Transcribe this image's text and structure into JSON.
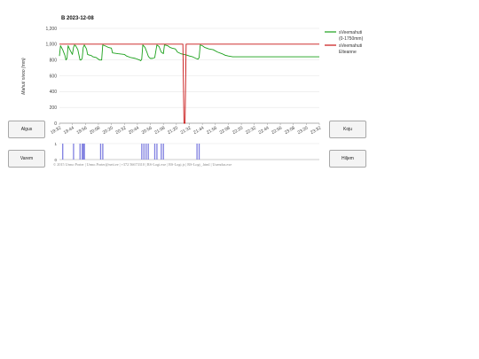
{
  "buttons": {
    "first": "Algus",
    "home": "Koju",
    "earlier": "Varem",
    "later": "Hiljem"
  },
  "footer": "© 2015 Urmo Porter | Urmo.Porter@neti.ee | +372 56673310 | RS-Logi.exe | RS-Logi.js | RS-Logi_.html | Uuendus.exe",
  "chart_data": [
    {
      "type": "line",
      "title": "B 2023-12-08",
      "ylabel": "Mahuti nivoo (mm)",
      "xlabel": "",
      "ylim": [
        0,
        1200
      ],
      "yticks": [
        0,
        200,
        400,
        600,
        800,
        "1,000",
        "1,200"
      ],
      "yticks_values": [
        0,
        200,
        400,
        600,
        800,
        1000,
        1200
      ],
      "xticks": [
        "19:32",
        "19:44",
        "19:56",
        "20:08",
        "20:20",
        "20:32",
        "20:44",
        "20:56",
        "21:08",
        "21:20",
        "21:32",
        "21:44",
        "21:56",
        "22:08",
        "22:20",
        "22:32",
        "22:44",
        "22:56",
        "23:08",
        "23:20",
        "23:32"
      ],
      "x_range": [
        "19:32",
        "23:32"
      ],
      "grid": true,
      "legend_position": "right",
      "colors": {
        "series1": "#1aa01a",
        "series2": "#c81414",
        "axis": "#999999",
        "grid": "#e6e6e6"
      },
      "series": [
        {
          "name": "sVeemahuti (0-1750mm)",
          "points": [
            [
              "19:32",
              850
            ],
            [
              "19:33",
              980
            ],
            [
              "19:35",
              930
            ],
            [
              "19:37",
              860
            ],
            [
              "19:38",
              800
            ],
            [
              "19:39",
              820
            ],
            [
              "19:40",
              980
            ],
            [
              "19:42",
              920
            ],
            [
              "19:44",
              870
            ],
            [
              "19:45",
              960
            ],
            [
              "19:46",
              990
            ],
            [
              "19:47",
              980
            ],
            [
              "19:49",
              930
            ],
            [
              "19:51",
              800
            ],
            [
              "19:52",
              800
            ],
            [
              "19:53",
              820
            ],
            [
              "19:54",
              960
            ],
            [
              "19:55",
              990
            ],
            [
              "19:57",
              940
            ],
            [
              "19:58",
              870
            ],
            [
              "20:00",
              860
            ],
            [
              "20:01",
              860
            ],
            [
              "20:03",
              840
            ],
            [
              "20:06",
              830
            ],
            [
              "20:09",
              800
            ],
            [
              "20:11",
              800
            ],
            [
              "20:12",
              990
            ],
            [
              "20:14",
              980
            ],
            [
              "20:17",
              960
            ],
            [
              "20:20",
              950
            ],
            [
              "20:21",
              890
            ],
            [
              "20:26",
              880
            ],
            [
              "20:32",
              870
            ],
            [
              "20:34",
              850
            ],
            [
              "20:38",
              830
            ],
            [
              "20:42",
              820
            ],
            [
              "20:46",
              800
            ],
            [
              "20:47",
              790
            ],
            [
              "20:48",
              810
            ],
            [
              "20:49",
              990
            ],
            [
              "20:51",
              960
            ],
            [
              "20:53",
              890
            ],
            [
              "20:54",
              850
            ],
            [
              "20:55",
              830
            ],
            [
              "20:56",
              820
            ],
            [
              "20:58",
              820
            ],
            [
              "21:00",
              830
            ],
            [
              "21:02",
              990
            ],
            [
              "21:04",
              970
            ],
            [
              "21:06",
              900
            ],
            [
              "21:08",
              880
            ],
            [
              "21:09",
              990
            ],
            [
              "21:12",
              980
            ],
            [
              "21:14",
              960
            ],
            [
              "21:16",
              950
            ],
            [
              "21:19",
              940
            ],
            [
              "21:21",
              900
            ],
            [
              "21:24",
              880
            ],
            [
              "21:27",
              870
            ],
            [
              "21:30",
              860
            ],
            [
              "21:32",
              850
            ],
            [
              "21:35",
              840
            ],
            [
              "21:38",
              820
            ],
            [
              "21:40",
              810
            ],
            [
              "21:41",
              830
            ],
            [
              "21:42",
              990
            ],
            [
              "21:44",
              980
            ],
            [
              "21:46",
              960
            ],
            [
              "21:50",
              940
            ],
            [
              "21:54",
              930
            ],
            [
              "21:58",
              900
            ],
            [
              "22:02",
              880
            ],
            [
              "22:05",
              860
            ],
            [
              "22:08",
              850
            ],
            [
              "22:12",
              840
            ],
            [
              "22:16",
              840
            ],
            [
              "22:20",
              840
            ],
            [
              "22:24",
              840
            ],
            [
              "22:28",
              840
            ],
            [
              "22:32",
              840
            ],
            [
              "22:36",
              840
            ],
            [
              "22:40",
              840
            ],
            [
              "22:44",
              840
            ],
            [
              "22:48",
              840
            ],
            [
              "22:52",
              840
            ],
            [
              "22:56",
              840
            ],
            [
              "23:00",
              840
            ],
            [
              "23:04",
              840
            ],
            [
              "23:08",
              840
            ],
            [
              "23:12",
              840
            ],
            [
              "23:16",
              840
            ],
            [
              "23:20",
              840
            ],
            [
              "23:24",
              840
            ],
            [
              "23:28",
              840
            ],
            [
              "23:32",
              840
            ]
          ]
        },
        {
          "name": "sVeemahuti Elteanne",
          "points": [
            [
              "19:32",
              1000
            ],
            [
              "21:26",
              1000
            ],
            [
              "21:27",
              0
            ],
            [
              "21:28",
              0
            ],
            [
              "21:29",
              1000
            ],
            [
              "23:32",
              1000
            ]
          ]
        }
      ]
    },
    {
      "type": "bar",
      "ylim": [
        0,
        1
      ],
      "yticks": [
        0,
        1
      ],
      "color": "#7f7fe0",
      "x_range": [
        "19:32",
        "23:32"
      ],
      "pulses": [
        "19:35",
        "19:45",
        "19:51",
        "19:53",
        "19:54",
        "19:55",
        "20:10",
        "20:12",
        "20:48",
        "20:50",
        "20:52",
        "20:54",
        "21:00",
        "21:02",
        "21:06",
        "21:08",
        "21:39",
        "21:41"
      ]
    }
  ]
}
